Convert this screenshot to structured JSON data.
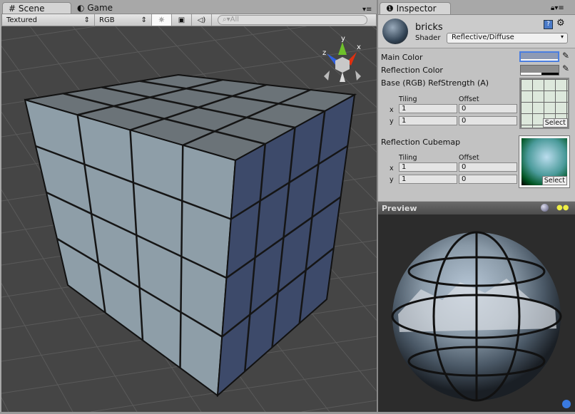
{
  "scene_panel": {
    "tabs": [
      {
        "label": "Scene",
        "icon": "grid-icon"
      },
      {
        "label": "Game",
        "icon": "pacman-icon"
      }
    ],
    "toolbar": {
      "render_mode": "Textured",
      "color_mode": "RGB",
      "search_placeholder": "All",
      "icons": [
        "sun-icon",
        "image-icon",
        "audio-icon",
        "search-icon"
      ]
    },
    "gizmo": {
      "y": "y",
      "x": "x",
      "z": "z"
    }
  },
  "inspector": {
    "tab": "Inspector",
    "material_name": "bricks",
    "shader_label": "Shader",
    "shader_value": "Reflective/Diffuse",
    "main_color_label": "Main Color",
    "main_color": "#8e9ab4",
    "reflection_color_label": "Reflection Color",
    "reflection_color": "#8c8c8c",
    "base_label": "Base (RGB) RefStrength (A)",
    "tiling_label": "Tiling",
    "offset_label": "Offset",
    "x_label": "x",
    "y_label": "y",
    "base": {
      "tiling_x": "1",
      "tiling_y": "1",
      "offset_x": "0",
      "offset_y": "0"
    },
    "cubemap_label": "Reflection Cubemap",
    "cubemap": {
      "tiling_x": "1",
      "tiling_y": "1",
      "offset_x": "0",
      "offset_y": "0"
    },
    "select_label": "Select"
  },
  "preview": {
    "title": "Preview"
  }
}
